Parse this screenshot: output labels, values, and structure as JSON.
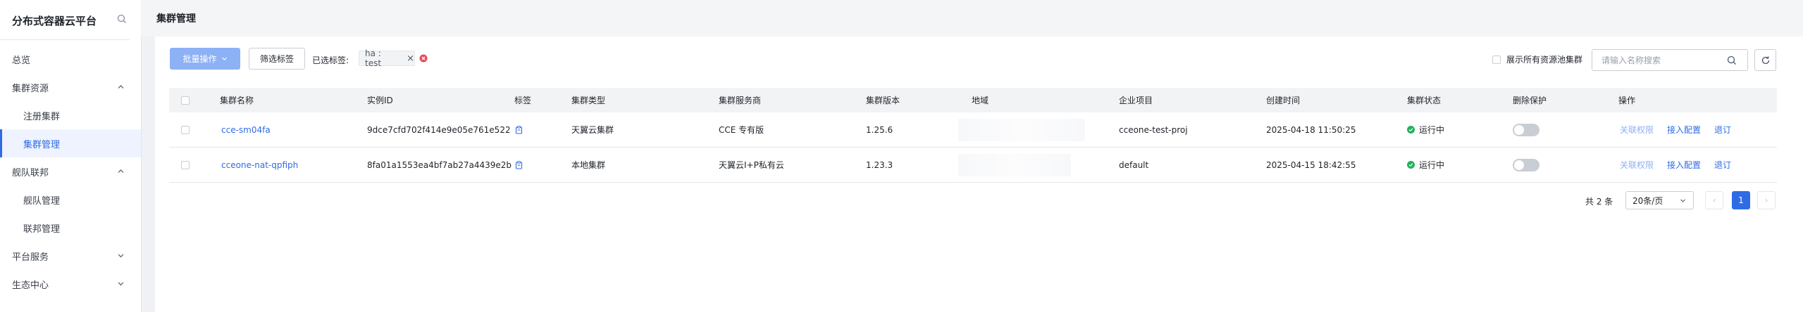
{
  "sidebar": {
    "title": "分布式容器云平台",
    "items": [
      {
        "label": "总览"
      },
      {
        "label": "集群资源"
      },
      {
        "label": "注册集群"
      },
      {
        "label": "集群管理"
      },
      {
        "label": "舰队联邦"
      },
      {
        "label": "舰队管理"
      },
      {
        "label": "联邦管理"
      },
      {
        "label": "平台服务"
      },
      {
        "label": "生态中心"
      }
    ]
  },
  "header": {
    "title": "集群管理"
  },
  "toolbar": {
    "batch_label": "批量操作",
    "filter_label": "筛选标签",
    "selected_tags_label": "已选标签:",
    "tag": {
      "key": "ha",
      "value": "test",
      "display": "ha : test"
    },
    "show_all_label": "展示所有资源池集群",
    "search_placeholder": "请输入名称搜索"
  },
  "table": {
    "columns": [
      "集群名称",
      "实例ID",
      "标签",
      "集群类型",
      "集群服务商",
      "集群版本",
      "地域",
      "企业项目",
      "创建时间",
      "集群状态",
      "删除保护",
      "操作"
    ],
    "rows": [
      {
        "name": "cce-sm04fa",
        "instance_id": "9dce7cfd702f414e9e05e761e522",
        "type": "天翼云集群",
        "provider": "CCE 专有版",
        "version": "1.25.6",
        "project": "cceone-test-proj",
        "created": "2025-04-18 11:50:25",
        "status": "运行中",
        "delete_protection": false,
        "actions": [
          "关联权限",
          "接入配置",
          "退订"
        ]
      },
      {
        "name": "cceone-nat-qpfiph",
        "instance_id": "8fa01a1553ea4bf7ab27a4439e2b",
        "type": "本地集群",
        "provider": "天翼云I+P私有云",
        "version": "1.23.3",
        "project": "default",
        "created": "2025-04-15 18:42:55",
        "status": "运行中",
        "delete_protection": false,
        "actions": [
          "关联权限",
          "接入配置",
          "退订"
        ]
      }
    ]
  },
  "pagination": {
    "total_label": "共 2 条",
    "page_size_label": "20条/页",
    "current_page": "1",
    "prev_symbol": "‹",
    "next_symbol": "›"
  },
  "colors": {
    "accent": "#2e6ce6",
    "status_running": "#20b25b",
    "clear_tag": "#e34d59"
  }
}
